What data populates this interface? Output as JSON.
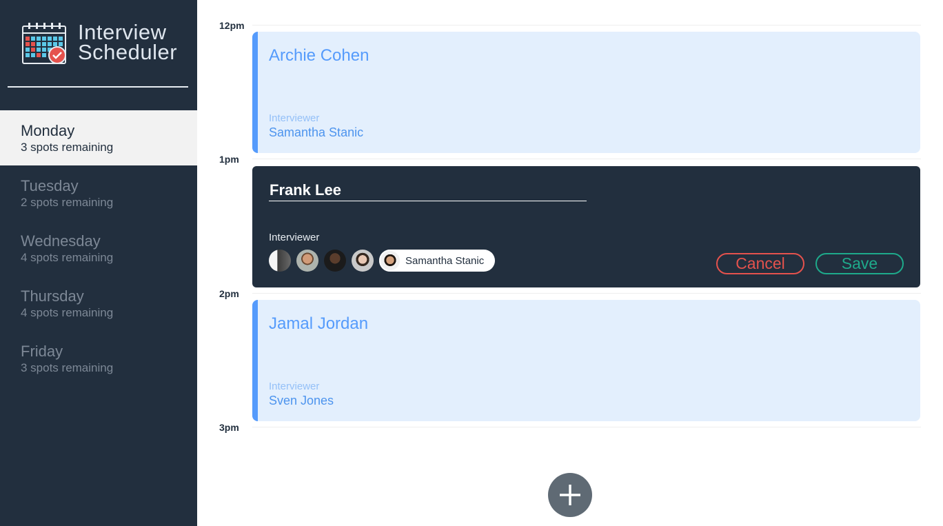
{
  "app": {
    "title_line1": "Interview",
    "title_line2": "Scheduler"
  },
  "days": [
    {
      "name": "Monday",
      "spots": "3 spots remaining",
      "selected": true
    },
    {
      "name": "Tuesday",
      "spots": "2 spots remaining",
      "selected": false
    },
    {
      "name": "Wednesday",
      "spots": "4 spots remaining",
      "selected": false
    },
    {
      "name": "Thursday",
      "spots": "4 spots remaining",
      "selected": false
    },
    {
      "name": "Friday",
      "spots": "3 spots remaining",
      "selected": false
    }
  ],
  "times": [
    "12pm",
    "1pm",
    "2pm",
    "3pm"
  ],
  "appointments": [
    {
      "student": "Archie Cohen",
      "interviewer_label": "Interviewer",
      "interviewer": "Samantha Stanic"
    },
    {
      "student": "Jamal Jordan",
      "interviewer_label": "Interviewer",
      "interviewer": "Sven Jones"
    }
  ],
  "editor": {
    "student_value": "Frank Lee",
    "interviewer_label": "Interviewer",
    "selected_interviewer": "Samantha Stanic",
    "cancel_label": "Cancel",
    "save_label": "Save"
  },
  "colors": {
    "sidebar": "#222f3e",
    "accent_blue": "#559bfc",
    "appointment_bg": "#e3effd",
    "cancel": "#e5524d",
    "save": "#1eaa8b",
    "add_button": "#5f6a74"
  },
  "icons": {
    "logo": "calendar-check-icon",
    "add": "plus-icon"
  }
}
